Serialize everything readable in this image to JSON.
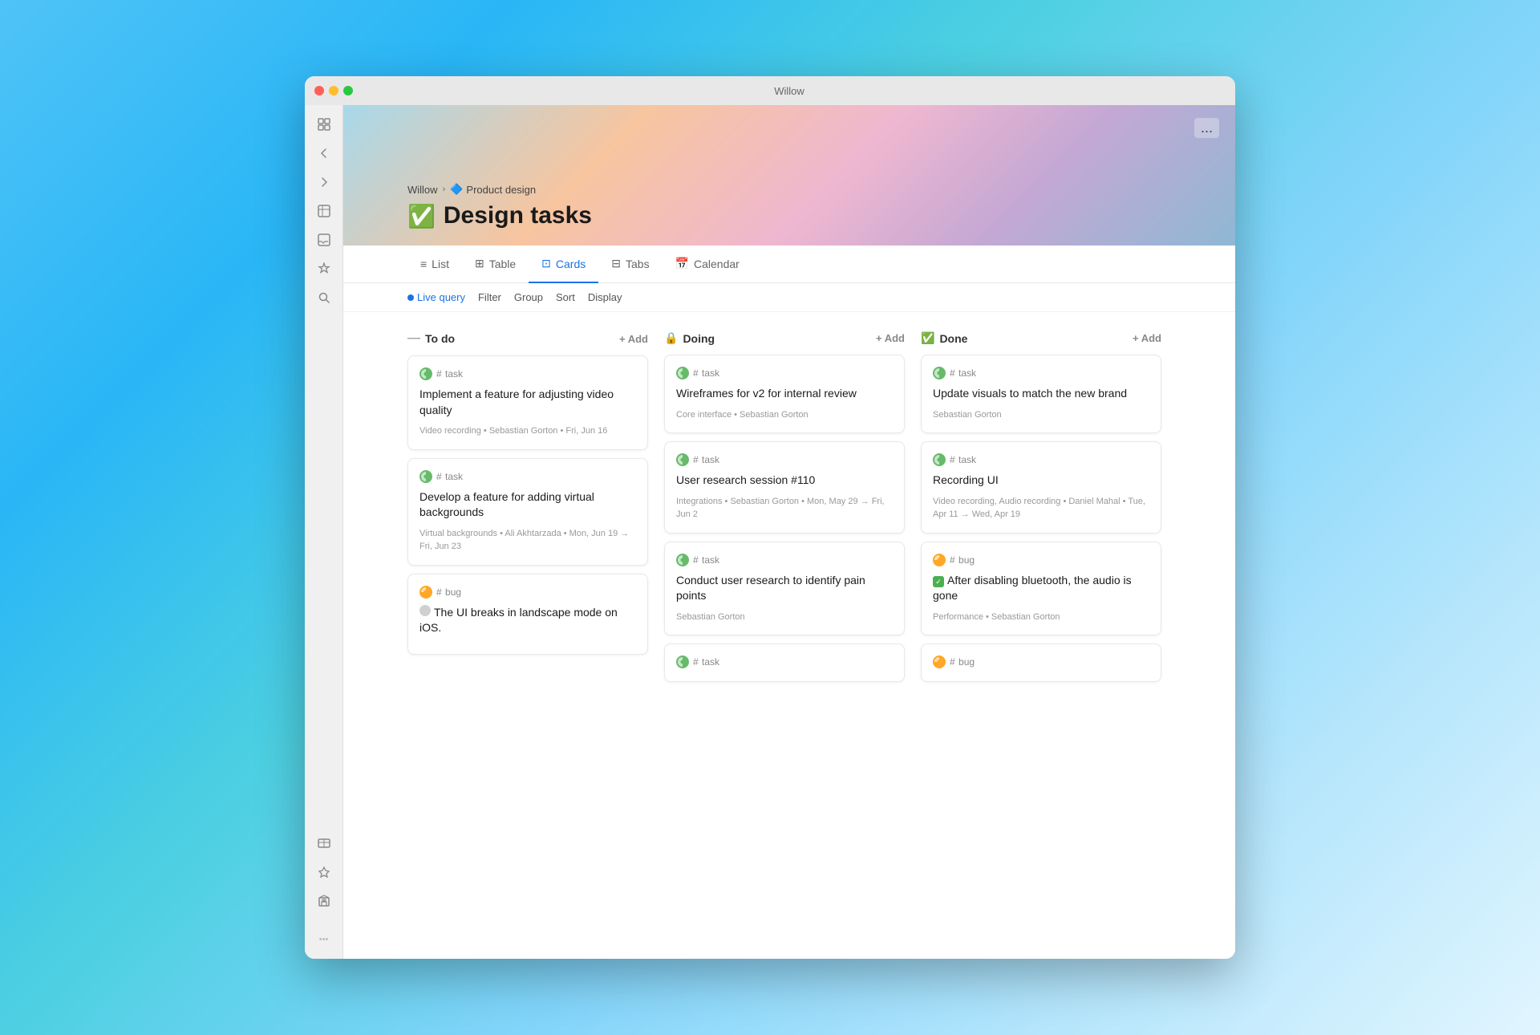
{
  "window": {
    "title": "Willow"
  },
  "breadcrumb": {
    "parent": "Willow",
    "separator": ">",
    "icon": "🔷",
    "current": "Product design"
  },
  "page": {
    "title": "Design tasks",
    "emoji": "✅",
    "menu_btn": "..."
  },
  "nav": {
    "tabs": [
      {
        "id": "list",
        "icon": "≡",
        "label": "List",
        "active": false
      },
      {
        "id": "table",
        "icon": "⊞",
        "label": "Table",
        "active": false
      },
      {
        "id": "cards",
        "icon": "⊡",
        "label": "Cards",
        "active": true
      },
      {
        "id": "tabs",
        "icon": "⊟",
        "label": "Tabs",
        "active": false
      },
      {
        "id": "calendar",
        "icon": "⊟",
        "label": "Calendar",
        "active": false
      }
    ]
  },
  "filters": {
    "live_query": "Live query",
    "filter": "Filter",
    "group": "Group",
    "sort": "Sort",
    "display": "Display"
  },
  "columns": [
    {
      "id": "todo",
      "icon": "—",
      "title": "To do",
      "add_label": "+ Add",
      "cards": [
        {
          "type": "task",
          "tag": "# task",
          "title": "Implement a feature for adjusting video quality",
          "meta": "Video recording • Sebastian Gorton • Fri, Jun 16"
        },
        {
          "type": "task",
          "tag": "# task",
          "title": "Develop a feature for adding virtual backgrounds",
          "meta": "Virtual backgrounds • Ali Akhtarzada • Mon, Jun 19 → Fri, Jun 23"
        },
        {
          "type": "bug",
          "tag": "# bug",
          "title": "The UI breaks in landscape mode on iOS.",
          "meta": ""
        }
      ]
    },
    {
      "id": "doing",
      "icon": "🔒",
      "title": "Doing",
      "add_label": "+ Add",
      "cards": [
        {
          "type": "task",
          "tag": "# task",
          "title": "Wireframes for v2 for internal review",
          "meta": "Core interface • Sebastian Gorton"
        },
        {
          "type": "task",
          "tag": "# task",
          "title": "User research session #110",
          "meta": "Integrations • Sebastian Gorton • Mon, May 29 → Fri, Jun 2"
        },
        {
          "type": "task",
          "tag": "# task",
          "title": "Conduct user research to identify pain points",
          "meta": "Sebastian Gorton"
        },
        {
          "type": "task",
          "tag": "# task",
          "title": "",
          "meta": ""
        }
      ]
    },
    {
      "id": "done",
      "icon": "✅",
      "title": "Done",
      "add_label": "+ Add",
      "cards": [
        {
          "type": "task",
          "tag": "# task",
          "title": "Update visuals to match the new brand",
          "meta": "Sebastian Gorton"
        },
        {
          "type": "task",
          "tag": "# task",
          "title": "Recording UI",
          "meta": "Video recording, Audio recording • Daniel Mahal • Tue, Apr 11 → Wed, Apr 19"
        },
        {
          "type": "bug",
          "tag": "# bug",
          "title": "After disabling bluetooth, the audio is gone",
          "meta": "Performance • Sebastian Gorton",
          "done": true
        },
        {
          "type": "bug",
          "tag": "# bug",
          "title": "",
          "meta": ""
        }
      ]
    }
  ]
}
